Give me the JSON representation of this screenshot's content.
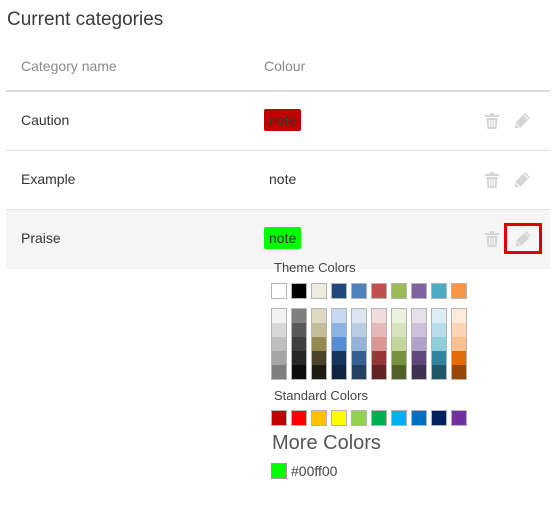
{
  "section_title": "Current categories",
  "table": {
    "headers": {
      "name": "Category name",
      "colour": "Colour"
    },
    "rows": [
      {
        "name": "Caution",
        "swatch_text": "note",
        "swatch_color": "#c00000"
      },
      {
        "name": "Example",
        "swatch_text": "note",
        "swatch_color": ""
      },
      {
        "name": "Praise",
        "swatch_text": "note",
        "swatch_color": "#00ff00"
      }
    ]
  },
  "icons": {
    "delete": "trash-icon",
    "edit": "pencil-icon"
  },
  "picker": {
    "theme_label": "Theme Colors",
    "theme_colors": [
      "#ffffff",
      "#000000",
      "#eeece1",
      "#1f497d",
      "#4f81bd",
      "#c0504d",
      "#9bbb59",
      "#8064a2",
      "#4bacc6",
      "#f79646"
    ],
    "theme_shades": [
      [
        "#f2f2f2",
        "#d8d8d8",
        "#bfbfbf",
        "#a5a5a5",
        "#7f7f7f"
      ],
      [
        "#7f7f7f",
        "#595959",
        "#3f3f3f",
        "#262626",
        "#0c0c0c"
      ],
      [
        "#ddd9c3",
        "#c4bd97",
        "#938953",
        "#494429",
        "#1d1b10"
      ],
      [
        "#c6d9f0",
        "#8db3e2",
        "#548dd4",
        "#17365d",
        "#0f243e"
      ],
      [
        "#dbe5f1",
        "#b8cce4",
        "#95b3d7",
        "#366092",
        "#244061"
      ],
      [
        "#f2dcdb",
        "#e5b9b7",
        "#d99694",
        "#953734",
        "#632423"
      ],
      [
        "#ebf1dd",
        "#d7e3bc",
        "#c3d69b",
        "#76923c",
        "#4f6128"
      ],
      [
        "#e5e0ec",
        "#ccc1d9",
        "#b2a2c7",
        "#5f497a",
        "#3f3151"
      ],
      [
        "#dbeef3",
        "#b7dde8",
        "#92cddc",
        "#31859b",
        "#205867"
      ],
      [
        "#fdeada",
        "#fbd5b5",
        "#fac08f",
        "#e36c09",
        "#974806"
      ]
    ],
    "standard_label": "Standard Colors",
    "standard_colors": [
      "#c00000",
      "#ff0000",
      "#ffc000",
      "#ffff00",
      "#92d050",
      "#00b050",
      "#00b0f0",
      "#0070c0",
      "#002060",
      "#7030a0"
    ],
    "more_colors_label": "More Colors",
    "custom_hex": "#00ff00",
    "custom_color": "#00ff00"
  }
}
